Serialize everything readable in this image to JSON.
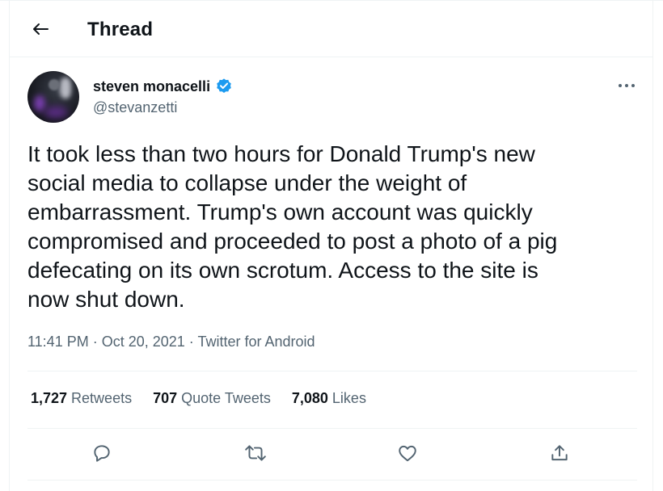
{
  "header": {
    "title": "Thread",
    "back_icon": "arrow-left-icon"
  },
  "tweet": {
    "author": {
      "name": "steven monacelli",
      "handle": "@stevanzetti",
      "verified": true,
      "verified_color": "#1d9bf0"
    },
    "text": "It took less than two hours for Donald Trump's new\nsocial media to collapse under the weight of\nembarrassment. Trump's own account was quickly\ncompromised and proceeded to post a photo of a pig\ndefecating on its own scrotum. Access to the site is\nnow shut down.",
    "time": "11:41 PM",
    "date": "Oct 20, 2021",
    "source": "Twitter for Android",
    "separator": " · "
  },
  "stats": {
    "retweets_count": "1,727",
    "retweets_label": "Retweets",
    "quotes_count": "707",
    "quotes_label": "Quote Tweets",
    "likes_count": "7,080",
    "likes_label": "Likes"
  },
  "actions": [
    "reply-icon",
    "retweet-icon",
    "like-icon",
    "share-icon"
  ],
  "colors": {
    "text_primary": "#0f1419",
    "text_secondary": "#536471",
    "border": "#eff3f4",
    "accent": "#1d9bf0"
  }
}
